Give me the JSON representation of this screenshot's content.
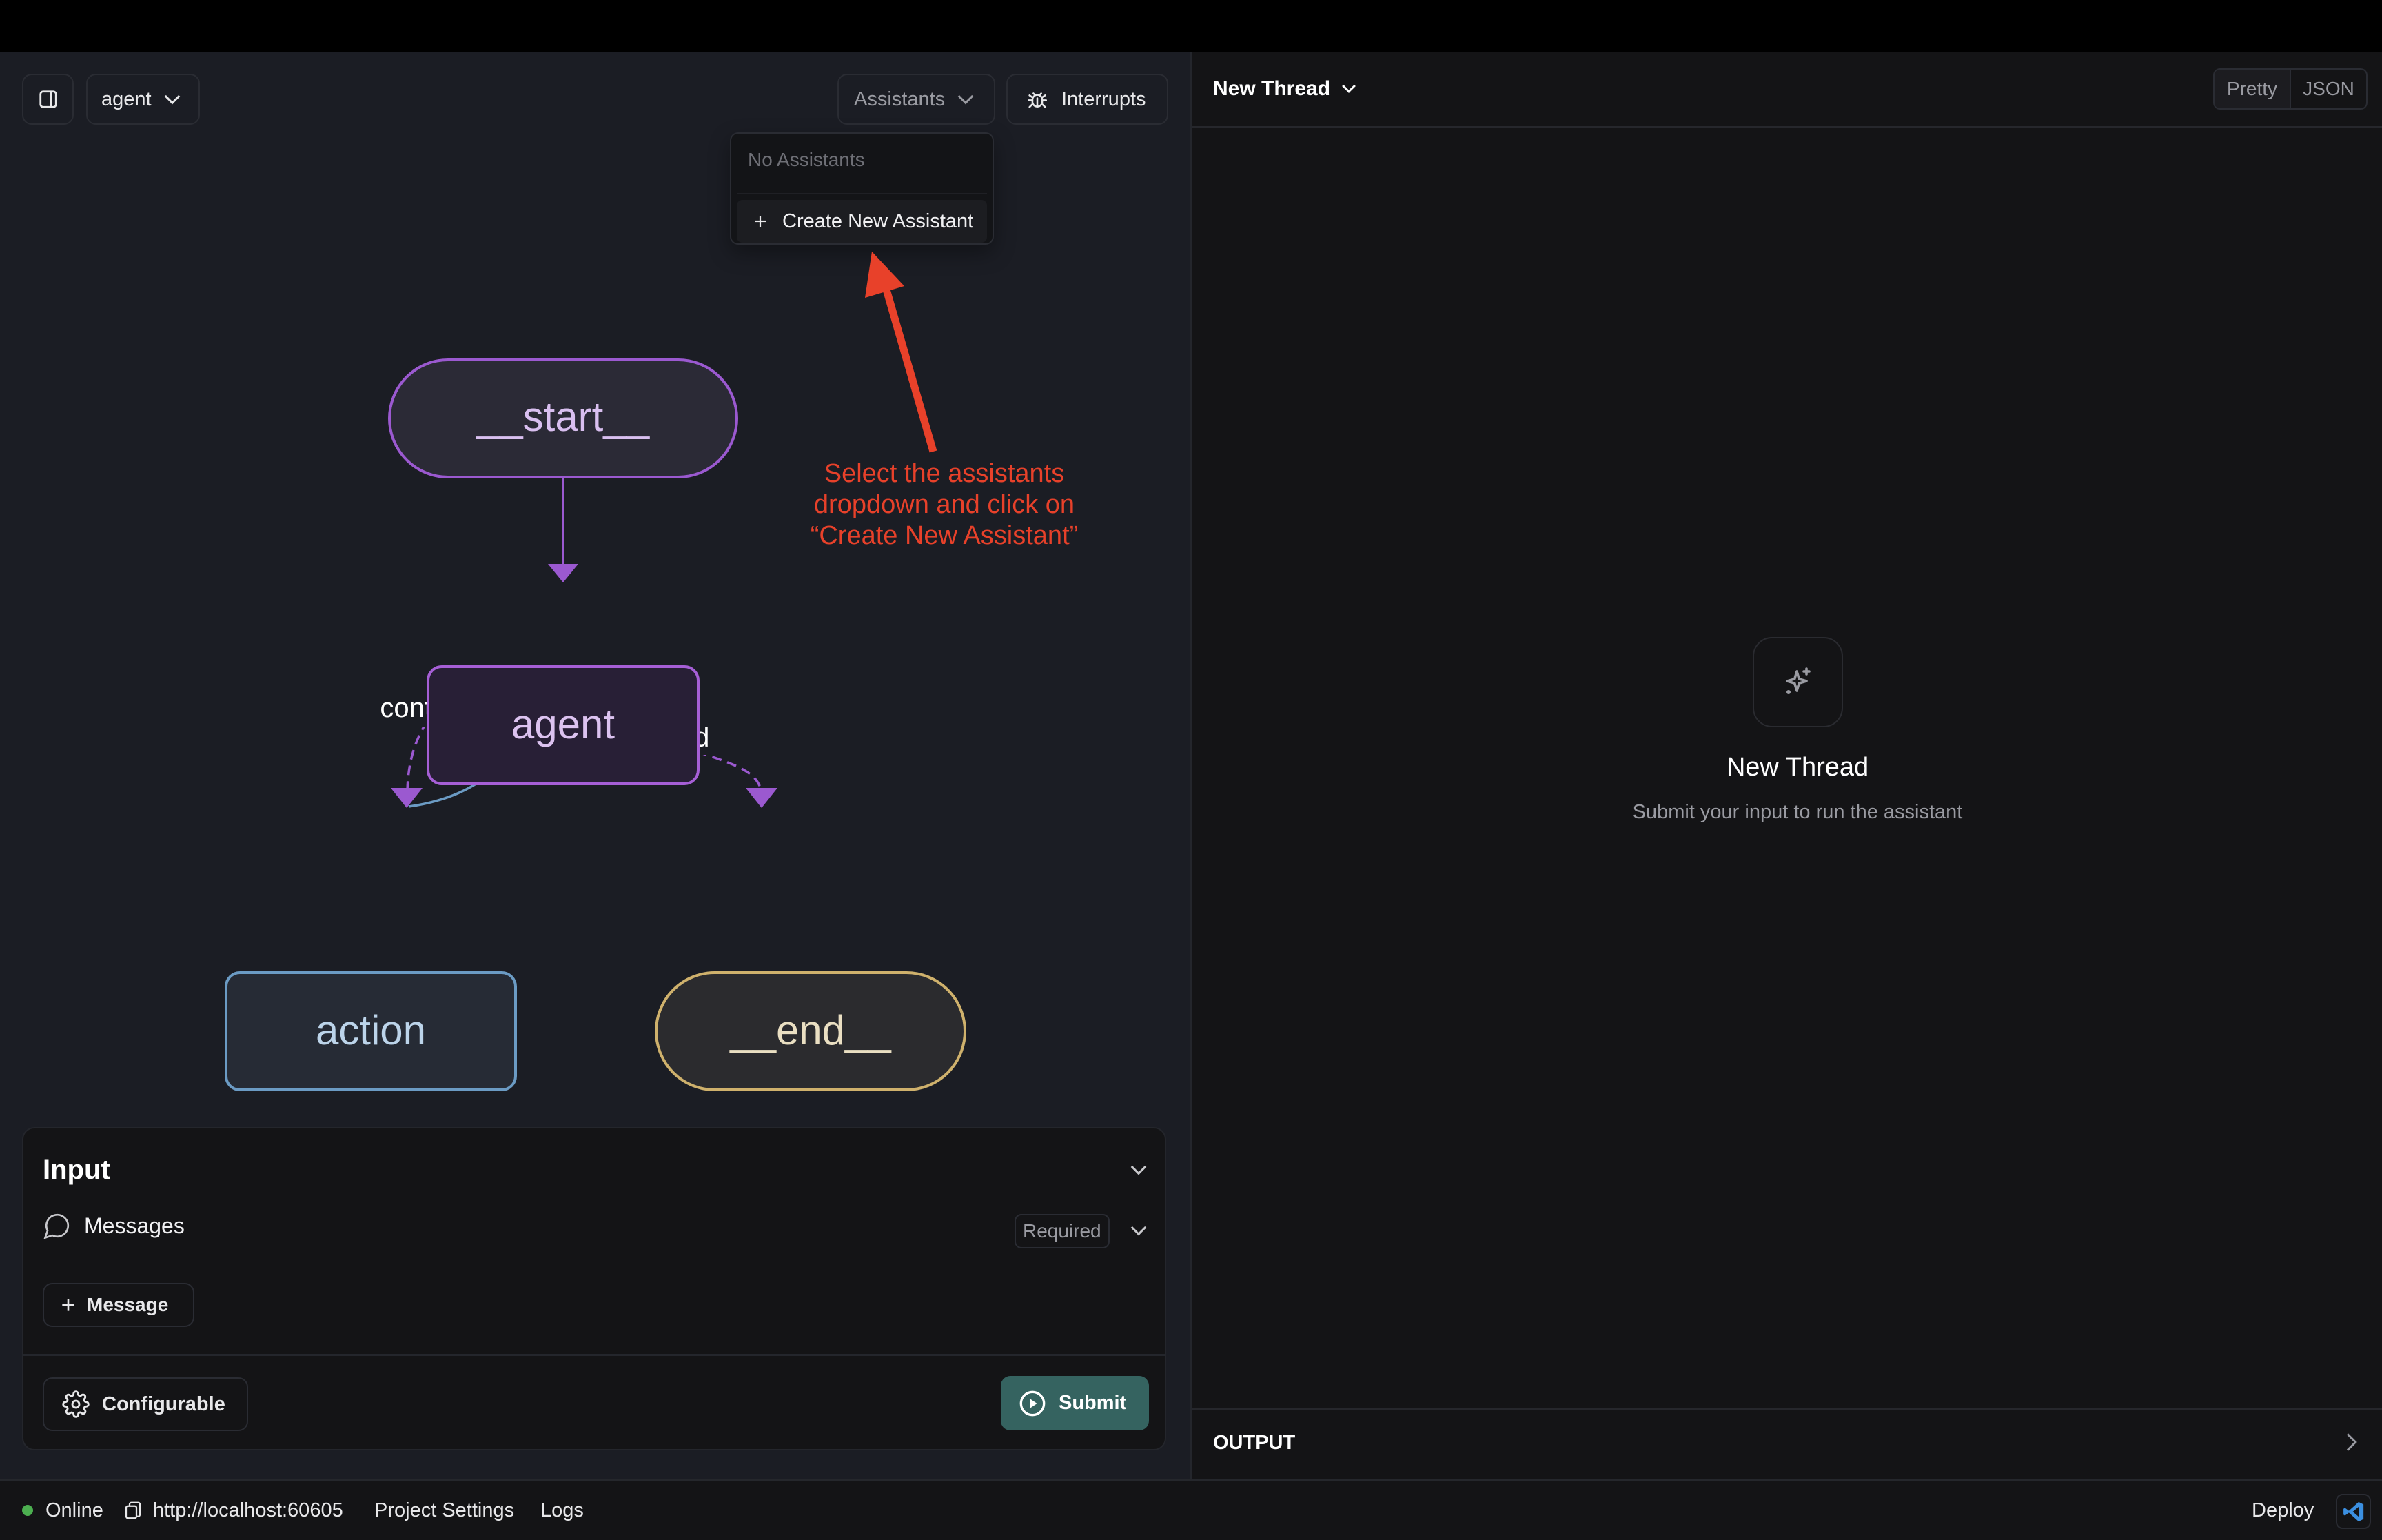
{
  "header": {
    "graph_select": "agent",
    "assistants_label": "Assistants",
    "interrupts_label": "Interrupts"
  },
  "assistants_dropdown": {
    "empty_text": "No Assistants",
    "create_label": "Create New Assistant"
  },
  "annotation": {
    "lines": [
      "Select the assistants",
      "dropdown and click on",
      "“Create New Assistant”"
    ],
    "color": "#e8412a"
  },
  "graph": {
    "nodes": {
      "start": "__start__",
      "agent": "agent",
      "action": "action",
      "end": "__end__"
    },
    "edges": {
      "continue": "continue",
      "end": "end"
    }
  },
  "input_panel": {
    "title": "Input",
    "messages_label": "Messages",
    "required_badge": "Required",
    "add_message_label": "Message",
    "configurable_label": "Configurable",
    "submit_label": "Submit",
    "submit_color": "#356360"
  },
  "thread": {
    "select_label": "New Thread",
    "view_pretty": "Pretty",
    "view_json": "JSON",
    "empty_title": "New Thread",
    "empty_subtitle": "Submit your input to run the assistant",
    "output_label": "OUTPUT"
  },
  "footer": {
    "status": "Online",
    "status_color": "#4caf50",
    "url": "http://localhost:60605",
    "project_settings": "Project Settings",
    "logs": "Logs",
    "deploy": "Deploy"
  }
}
